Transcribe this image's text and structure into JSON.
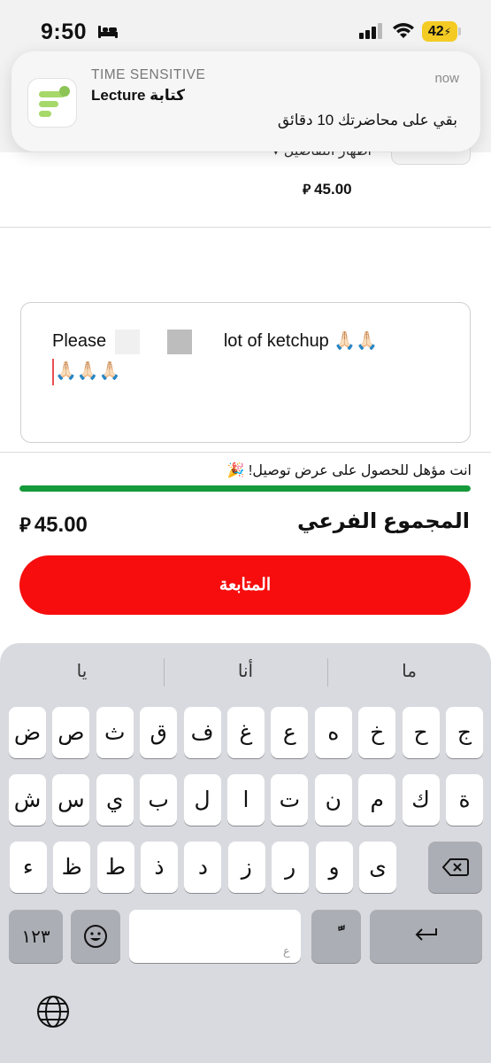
{
  "status_bar": {
    "time": "9:50",
    "battery": "42"
  },
  "notification": {
    "label": "TIME SENSITIVE",
    "title": "Lecture كتابة",
    "time": "now",
    "body": "بقي على محاضرتك 10 دقائق",
    "app_icon": "lecture-app-icon"
  },
  "order_item": {
    "details_label": "اظهار التفاصيل",
    "price": "45.00"
  },
  "notes": {
    "text_before": "Please",
    "text_after": "lot of ketchup 🙏🏻🙏🏻",
    "text_line2": "🙏🏻🙏🏻🙏🏻"
  },
  "delivery": {
    "message": "انت مؤهل للحصول على عرض توصيل! 🎉",
    "progress_percent": 100,
    "progress_color": "#159a3c"
  },
  "subtotal": {
    "label": "المجموع الفرعي",
    "value": "45.00"
  },
  "currency_symbol": "⃁",
  "continue_button": {
    "label": "المتابعة",
    "color": "#f70d0d"
  },
  "keyboard": {
    "suggestions": [
      "ما",
      "أنا",
      "يا"
    ],
    "row1": [
      "ج",
      "ح",
      "خ",
      "ه",
      "ع",
      "غ",
      "ف",
      "ق",
      "ث",
      "ص",
      "ض"
    ],
    "row2": [
      "ة",
      "ك",
      "م",
      "ن",
      "ت",
      "ا",
      "ل",
      "ب",
      "ي",
      "س",
      "ش"
    ],
    "row3": [
      "ى",
      "و",
      "ر",
      "ز",
      "د",
      "ذ",
      "ط",
      "ظ",
      "ء"
    ],
    "numbers_key": "١٢٣",
    "space_hint": "ع",
    "tanween_key": "ًّ",
    "icons": {
      "delete": "delete-icon",
      "return": "return-icon",
      "emoji": "emoji-icon",
      "globe": "globe-icon"
    }
  }
}
